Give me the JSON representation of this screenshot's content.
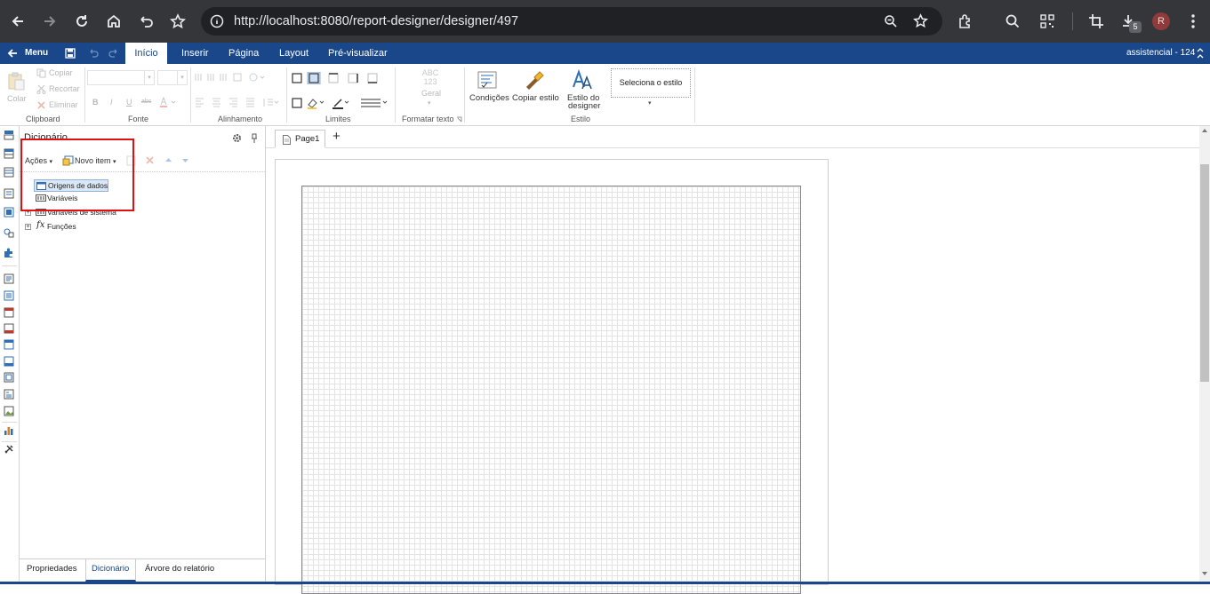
{
  "browser": {
    "url": "http://localhost:8080/report-designer/designer/497",
    "download_count": "5",
    "avatar_letter": "R"
  },
  "menubar": {
    "menu_label": "Menu",
    "tabs": [
      "Início",
      "Inserir",
      "Página",
      "Layout",
      "Pré-visualizar"
    ],
    "active_tab": "Início",
    "user": "assistencial - 124"
  },
  "ribbon": {
    "clipboard": {
      "paste": "Colar",
      "copy": "Copiar",
      "cut": "Recortar",
      "delete": "Eliminar",
      "label": "Clipboard"
    },
    "font": {
      "label": "Fonte",
      "bold": "B",
      "italic": "I",
      "underline": "U",
      "strike": "abc"
    },
    "alignment": {
      "label": "Alinhamento"
    },
    "borders": {
      "label": "Limites"
    },
    "text_format": {
      "label": "Formatar texto",
      "icon_line1": "ABC",
      "icon_line2": "123",
      "value": "Geral"
    },
    "style": {
      "conditions": "Condições",
      "copy_style": "Copiar estilo",
      "designer_style_1": "Estilo do",
      "designer_style_2": "designer",
      "select_style": "Seleciona o estilo",
      "label": "Estilo"
    }
  },
  "dictionary": {
    "title": "Dicionário",
    "actions": "Ações",
    "new_item": "Novo item",
    "tree": [
      "Origens de dados",
      "Variáveis",
      "Variáveis de sistema",
      "Funções"
    ],
    "bottom_tabs": [
      "Propriedades",
      "Dicionário",
      "Árvore do relatório"
    ],
    "active_bottom_tab": "Dicionário"
  },
  "designer": {
    "page_tab": "Page1",
    "add_page": "+"
  },
  "colors": {
    "brand": "#19478a",
    "highlight": "#e01010"
  }
}
